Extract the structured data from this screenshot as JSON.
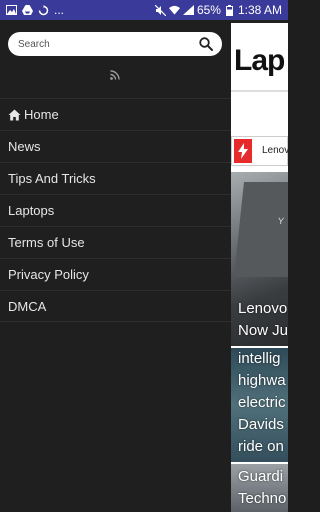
{
  "status_bar": {
    "battery": "65%",
    "time": "1:38 AM",
    "ellipsis": "...",
    "icons": [
      "gallery-icon",
      "drive-icon",
      "sync-icon",
      "mute-icon",
      "wifi-icon",
      "signal-icon",
      "battery-icon"
    ]
  },
  "drawer": {
    "search": {
      "placeholder": "Search",
      "icon": "search-icon"
    },
    "rss_icon": "rss-icon",
    "menu": [
      {
        "label": "Home",
        "icon": "home-icon"
      },
      {
        "label": "News"
      },
      {
        "label": "Tips And Tricks"
      },
      {
        "label": "Laptops"
      },
      {
        "label": "Terms of Use"
      },
      {
        "label": "Privacy Policy"
      },
      {
        "label": "DMCA"
      }
    ]
  },
  "content": {
    "logo": "Lap",
    "ticker": {
      "text": "Lenovo",
      "accent": "#e52b2b"
    },
    "cards": [
      {
        "lines": [
          "Lenovo",
          "Now Ju"
        ],
        "image_text": "Y"
      },
      {
        "lines": [
          "intellig",
          "highwa",
          "electric",
          "Davids",
          "ride on"
        ]
      },
      {
        "lines": [
          "Guardi",
          "Techno"
        ]
      }
    ]
  },
  "colors": {
    "status_bar": "#3a3a9a",
    "drawer_bg": "#1f1f1f",
    "menu_text": "#e6e6e6"
  }
}
